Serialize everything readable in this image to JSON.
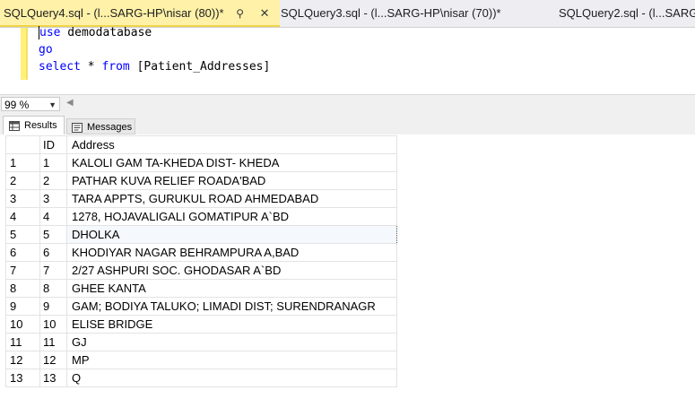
{
  "tabs": [
    {
      "label": "SQLQuery4.sql - (l...SARG-HP\\nisar (80))*",
      "active": true
    },
    {
      "label": "SQLQuery3.sql - (l...SARG-HP\\nisar (70))*",
      "active": false
    },
    {
      "label": "SQLQuery2.sql - (l...SARG",
      "active": false
    }
  ],
  "editor": {
    "line1_kw": "use",
    "line1_rest": " demodatabase",
    "line2": "go",
    "line3_kw1": "select",
    "line3_mid": " * ",
    "line3_kw2": "from",
    "line3_rest": " [Patient_Addresses]"
  },
  "zoom": {
    "value": "99 %"
  },
  "result_tabs": {
    "results": "Results",
    "messages": "Messages"
  },
  "grid": {
    "columns": [
      "ID",
      "Address"
    ],
    "selected_row": 5,
    "rows": [
      {
        "n": "1",
        "id": "1",
        "address": "KALOLI GAM TA-KHEDA DIST- KHEDA"
      },
      {
        "n": "2",
        "id": "2",
        "address": "PATHAR KUVA RELIEF ROADA'BAD"
      },
      {
        "n": "3",
        "id": "3",
        "address": "TARA APPTS, GURUKUL ROAD AHMEDABAD"
      },
      {
        "n": "4",
        "id": "4",
        "address": "1278, HOJAVALIGALI GOMATIPUR A`BD"
      },
      {
        "n": "5",
        "id": "5",
        "address": "DHOLKA"
      },
      {
        "n": "6",
        "id": "6",
        "address": "KHODIYAR NAGAR  BEHRAMPURA A,BAD"
      },
      {
        "n": "7",
        "id": "7",
        "address": "2/27 ASHPURI SOC. GHODASAR A`BD"
      },
      {
        "n": "8",
        "id": "8",
        "address": "GHEE KANTA"
      },
      {
        "n": "9",
        "id": "9",
        "address": "GAM; BODIYA TALUKO; LIMADI  DIST; SURENDRANAGR"
      },
      {
        "n": "10",
        "id": "10",
        "address": "ELISE BRIDGE"
      },
      {
        "n": "11",
        "id": "11",
        "address": "GJ"
      },
      {
        "n": "12",
        "id": "12",
        "address": "MP"
      },
      {
        "n": "13",
        "id": "13",
        "address": "Q"
      }
    ]
  }
}
